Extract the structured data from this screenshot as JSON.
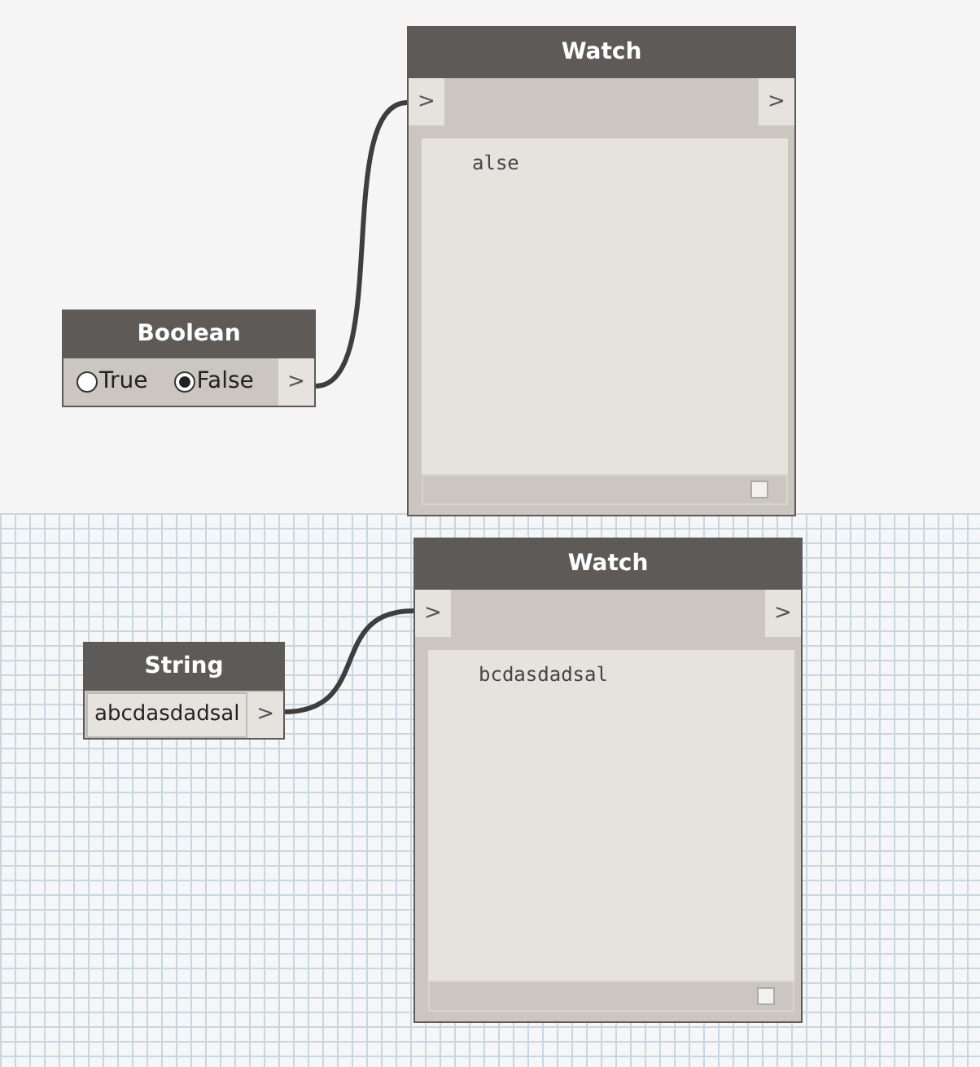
{
  "nodes": [
    {
      "kind": "watch",
      "title": "Watch",
      "input_port": ">",
      "output_port": ">",
      "value": "alse"
    },
    {
      "kind": "boolean",
      "title": "Boolean",
      "options": [
        {
          "label": "True",
          "selected": false
        },
        {
          "label": "False",
          "selected": true
        }
      ],
      "output_port": ">"
    },
    {
      "kind": "watch",
      "title": "Watch",
      "input_port": ">",
      "output_port": ">",
      "value": "bcdasdadsal"
    },
    {
      "kind": "string",
      "title": "String",
      "value": "abcdasdadsal",
      "output_port": ">"
    }
  ]
}
